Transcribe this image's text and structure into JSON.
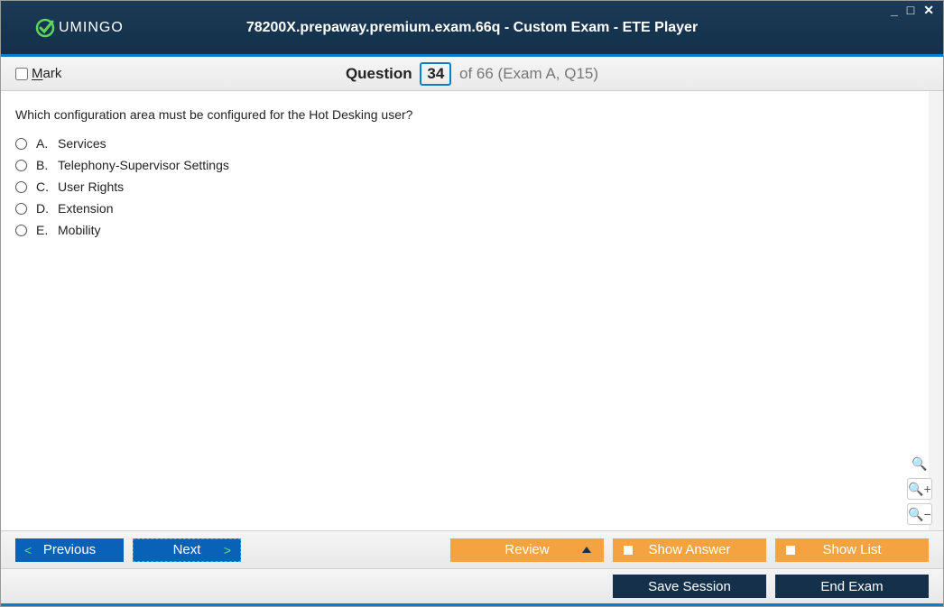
{
  "app": {
    "brand": "UMINGO",
    "title": "78200X.prepaway.premium.exam.66q - Custom Exam - ETE Player"
  },
  "header": {
    "markLabelFirst": "M",
    "markLabelRest": "ark",
    "questionWord": "Question",
    "currentNumber": "34",
    "totalText": "of 66 (Exam A, Q15)"
  },
  "question": {
    "text": "Which configuration area must be configured for the Hot Desking user?",
    "options": [
      {
        "letter": "A.",
        "text": "Services"
      },
      {
        "letter": "B.",
        "text": "Telephony-Supervisor Settings"
      },
      {
        "letter": "C.",
        "text": "User Rights"
      },
      {
        "letter": "D.",
        "text": "Extension"
      },
      {
        "letter": "E.",
        "text": "Mobility"
      }
    ]
  },
  "buttons": {
    "previous": "Previous",
    "next": "Next",
    "review": "Review",
    "showAnswer": "Show Answer",
    "showList": "Show List",
    "saveSession": "Save Session",
    "endExam": "End Exam"
  }
}
